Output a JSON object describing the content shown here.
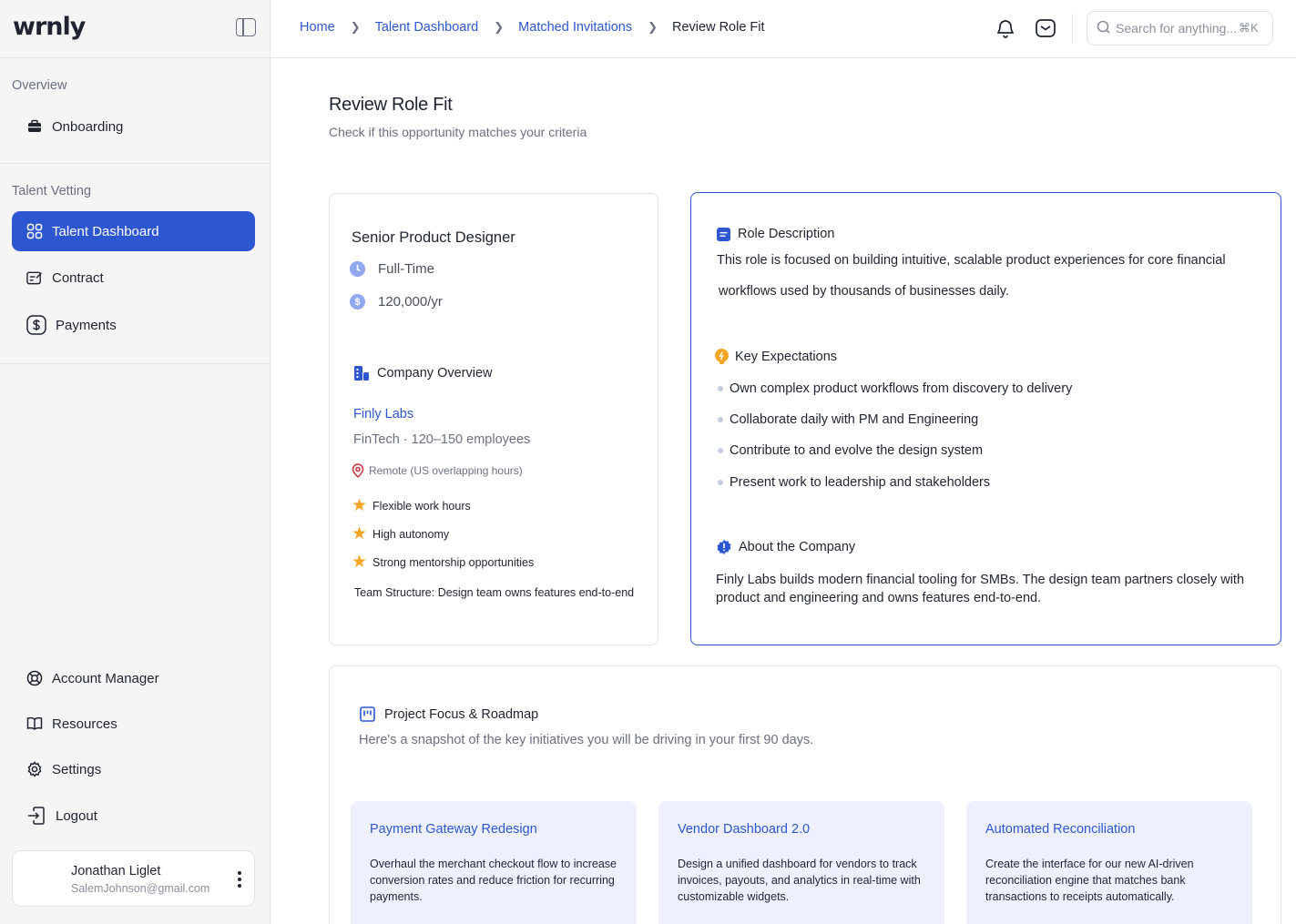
{
  "app": {
    "logo": "wrnly"
  },
  "sidebar": {
    "overview_label": "Overview",
    "talent_label": "Talent Vetting",
    "items": [
      {
        "label": "Onboarding",
        "icon": "briefcase-icon"
      },
      {
        "label": "Talent Dashboard",
        "icon": "grid-icon",
        "active": true
      },
      {
        "label": "Contract",
        "icon": "contract-icon"
      },
      {
        "label": "Payments",
        "icon": "dollar-icon"
      }
    ],
    "bottom_items": [
      {
        "label": "Account Manager",
        "icon": "lifebuoy-icon"
      },
      {
        "label": "Resources",
        "icon": "book-icon"
      },
      {
        "label": "Settings",
        "icon": "gear-icon"
      },
      {
        "label": "Logout",
        "icon": "logout-icon"
      }
    ],
    "user": {
      "name": "Jonathan Liglet",
      "email": "SalemJohnson@gmail.com"
    }
  },
  "header": {
    "breadcrumbs": [
      "Home",
      "Talent Dashboard",
      "Matched Invitations",
      "Review Role Fit"
    ],
    "search_placeholder": "Search for anything...",
    "search_shortcut": "⌘K"
  },
  "page": {
    "title": "Review Role Fit",
    "subtitle": "Check if this opportunity matches your criteria"
  },
  "role": {
    "title": "Senior Product Designer",
    "employment": "Full-Time",
    "salary": "120,000/yr",
    "company_heading": "Company Overview",
    "company_name": "Finly Labs",
    "company_meta": "FinTech · 120–150 employees",
    "location": "Remote (US overlapping hours)",
    "perks": [
      "Flexible work hours",
      "High autonomy",
      "Strong mentorship opportunities"
    ],
    "team_structure": "Team Structure: Design team owns features end-to-end"
  },
  "details": {
    "description_heading": "Role Description",
    "description_line1": "This role is focused on building intuitive, scalable product experiences for core financial",
    "description_line2": "workflows used by thousands of businesses daily.",
    "expectations_heading": "Key Expectations",
    "expectations": [
      "Own complex product workflows from discovery to delivery",
      "Collaborate daily with PM and Engineering",
      "Contribute to and evolve the design system",
      "Present work to leadership and stakeholders"
    ],
    "about_heading": "About the Company",
    "about_text": "Finly Labs builds modern financial tooling for SMBs. The design team partners closely with product and engineering and owns features end-to-end."
  },
  "roadmap": {
    "heading": "Project Focus & Roadmap",
    "subtitle": "Here's a snapshot of the key initiatives you will be driving in your first 90 days.",
    "projects": [
      {
        "title": "Payment Gateway Redesign",
        "text": "Overhaul the merchant checkout flow to increase conversion rates and reduce friction for recurring payments."
      },
      {
        "title": "Vendor Dashboard 2.0",
        "text": "Design a unified dashboard for vendors to track invoices, payouts, and analytics in real-time with customizable widgets."
      },
      {
        "title": "Automated Reconciliation",
        "text": "Create the interface for our new AI-driven reconciliation engine that matches bank transactions to receipts automatically."
      }
    ]
  },
  "colors": {
    "accent": "#2d57d1",
    "star": "#f5a524",
    "card_tint": "#eef1fd"
  }
}
